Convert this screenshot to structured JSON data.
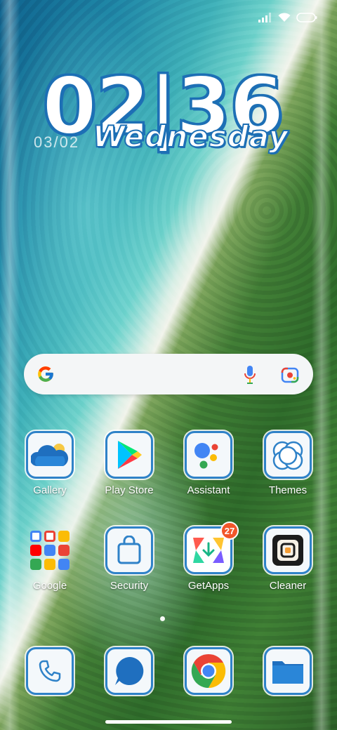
{
  "status_bar": {
    "icons": [
      "signal-icon",
      "wifi-icon",
      "battery-icon"
    ]
  },
  "clock": {
    "time": "02|36",
    "date": "03/02",
    "day": "Wednesday"
  },
  "search": {
    "icons": [
      "google-g-icon",
      "microphone-icon",
      "lens-icon"
    ]
  },
  "apps": [
    {
      "label": "Gallery",
      "icon": "cloud-sun-icon"
    },
    {
      "label": "Play Store",
      "icon": "play-triangle-icon"
    },
    {
      "label": "Assistant",
      "icon": "assistant-dots-icon"
    },
    {
      "label": "Themes",
      "icon": "circles-icon"
    },
    {
      "label": "Google",
      "icon": "folder-icon"
    },
    {
      "label": "Security",
      "icon": "shopping-bag-icon"
    },
    {
      "label": "GetApps",
      "icon": "download-arrow-icon",
      "badge": "27"
    },
    {
      "label": "Cleaner",
      "icon": "cleaner-icon"
    }
  ],
  "dock": [
    {
      "icon": "phone-icon"
    },
    {
      "icon": "messages-icon"
    },
    {
      "icon": "chrome-icon"
    },
    {
      "icon": "files-folder-icon"
    }
  ],
  "colors": {
    "icon_border": "#2f82c8",
    "badge": "#f2562a"
  }
}
